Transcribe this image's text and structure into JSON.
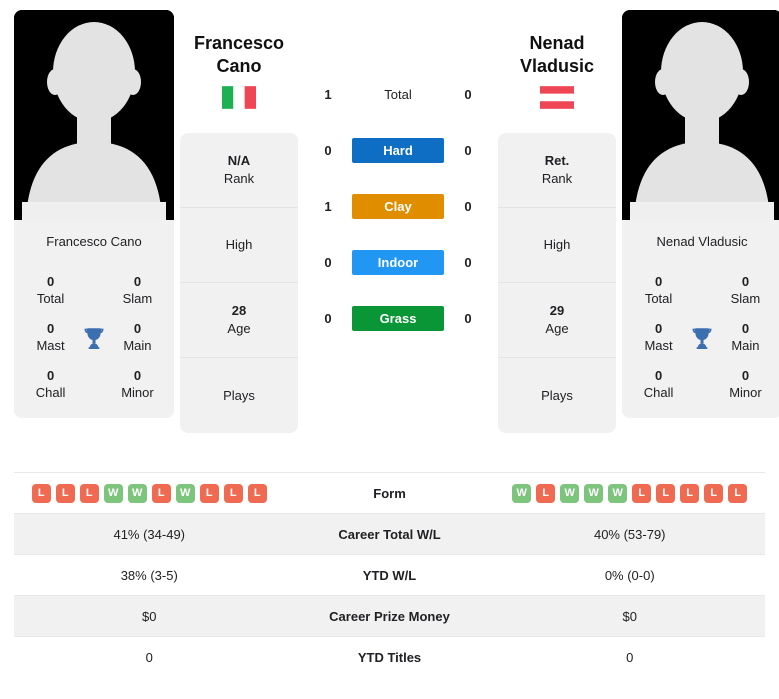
{
  "players": {
    "left": {
      "first_name": "Francesco",
      "last_name": "Cano",
      "full_name": "Francesco Cano",
      "country": "Italy",
      "flag_icon": "flag-italy-icon",
      "rank_value": "N/A",
      "rank_label": "Rank",
      "high_label": "High",
      "high_value": "",
      "age_value": "28",
      "age_label": "Age",
      "plays_label": "Plays",
      "plays_value": "",
      "titles": [
        {
          "value": "0",
          "label": "Total"
        },
        {
          "value": "0",
          "label": "Slam"
        },
        {
          "value": "0",
          "label": "Mast"
        },
        {
          "value": "0",
          "label": "Main"
        },
        {
          "value": "0",
          "label": "Chall"
        },
        {
          "value": "0",
          "label": "Minor"
        }
      ],
      "form": [
        "L",
        "L",
        "L",
        "W",
        "W",
        "L",
        "W",
        "L",
        "L",
        "L"
      ],
      "career_total_wl": "41% (34-49)",
      "ytd_wl": "38% (3-5)",
      "career_prize_money": "$0",
      "ytd_titles": "0"
    },
    "right": {
      "first_name": "Nenad",
      "last_name": "Vladusic",
      "full_name": "Nenad Vladusic",
      "country": "Austria",
      "flag_icon": "flag-austria-icon",
      "rank_value": "Ret.",
      "rank_label": "Rank",
      "high_label": "High",
      "high_value": "",
      "age_value": "29",
      "age_label": "Age",
      "plays_label": "Plays",
      "plays_value": "",
      "titles": [
        {
          "value": "0",
          "label": "Total"
        },
        {
          "value": "0",
          "label": "Slam"
        },
        {
          "value": "0",
          "label": "Mast"
        },
        {
          "value": "0",
          "label": "Main"
        },
        {
          "value": "0",
          "label": "Chall"
        },
        {
          "value": "0",
          "label": "Minor"
        }
      ],
      "form": [
        "W",
        "L",
        "W",
        "W",
        "W",
        "L",
        "L",
        "L",
        "L",
        "L"
      ],
      "career_total_wl": "40% (53-79)",
      "ytd_wl": "0% (0-0)",
      "career_prize_money": "$0",
      "ytd_titles": "0"
    }
  },
  "head_to_head": [
    {
      "surface": "Total",
      "left": "1",
      "right": "0",
      "color": "",
      "text_color": "#202124",
      "plain": true
    },
    {
      "surface": "Hard",
      "left": "0",
      "right": "0",
      "color": "#0d6ec4",
      "text_color": "#ffffff",
      "plain": false
    },
    {
      "surface": "Clay",
      "left": "1",
      "right": "0",
      "color": "#e08e00",
      "text_color": "#ffffff",
      "plain": false
    },
    {
      "surface": "Indoor",
      "left": "0",
      "right": "0",
      "color": "#2196f3",
      "text_color": "#ffffff",
      "plain": false
    },
    {
      "surface": "Grass",
      "left": "0",
      "right": "0",
      "color": "#0a9636",
      "text_color": "#ffffff",
      "plain": false
    }
  ],
  "stats_table": {
    "rows": [
      {
        "label": "Form",
        "type": "form",
        "shaded": false
      },
      {
        "label": "Career Total W/L",
        "type": "text",
        "shaded": true,
        "left": "41% (34-49)",
        "right": "40% (53-79)"
      },
      {
        "label": "YTD W/L",
        "type": "text",
        "shaded": false,
        "left": "38% (3-5)",
        "right": "0% (0-0)"
      },
      {
        "label": "Career Prize Money",
        "type": "text",
        "shaded": true,
        "left": "$0",
        "right": "$0"
      },
      {
        "label": "YTD Titles",
        "type": "text",
        "shaded": false,
        "left": "0",
        "right": "0"
      }
    ]
  },
  "icons": {
    "trophy": "trophy-icon",
    "avatar_placeholder": "avatar-placeholder-icon"
  },
  "colors": {
    "hard": "#0d6ec4",
    "clay": "#e08e00",
    "indoor": "#2196f3",
    "grass": "#0a9636",
    "win": "#7dc47d",
    "loss": "#ef6a51",
    "panel": "#f1f1f1",
    "trophy": "#3c6fb0"
  }
}
